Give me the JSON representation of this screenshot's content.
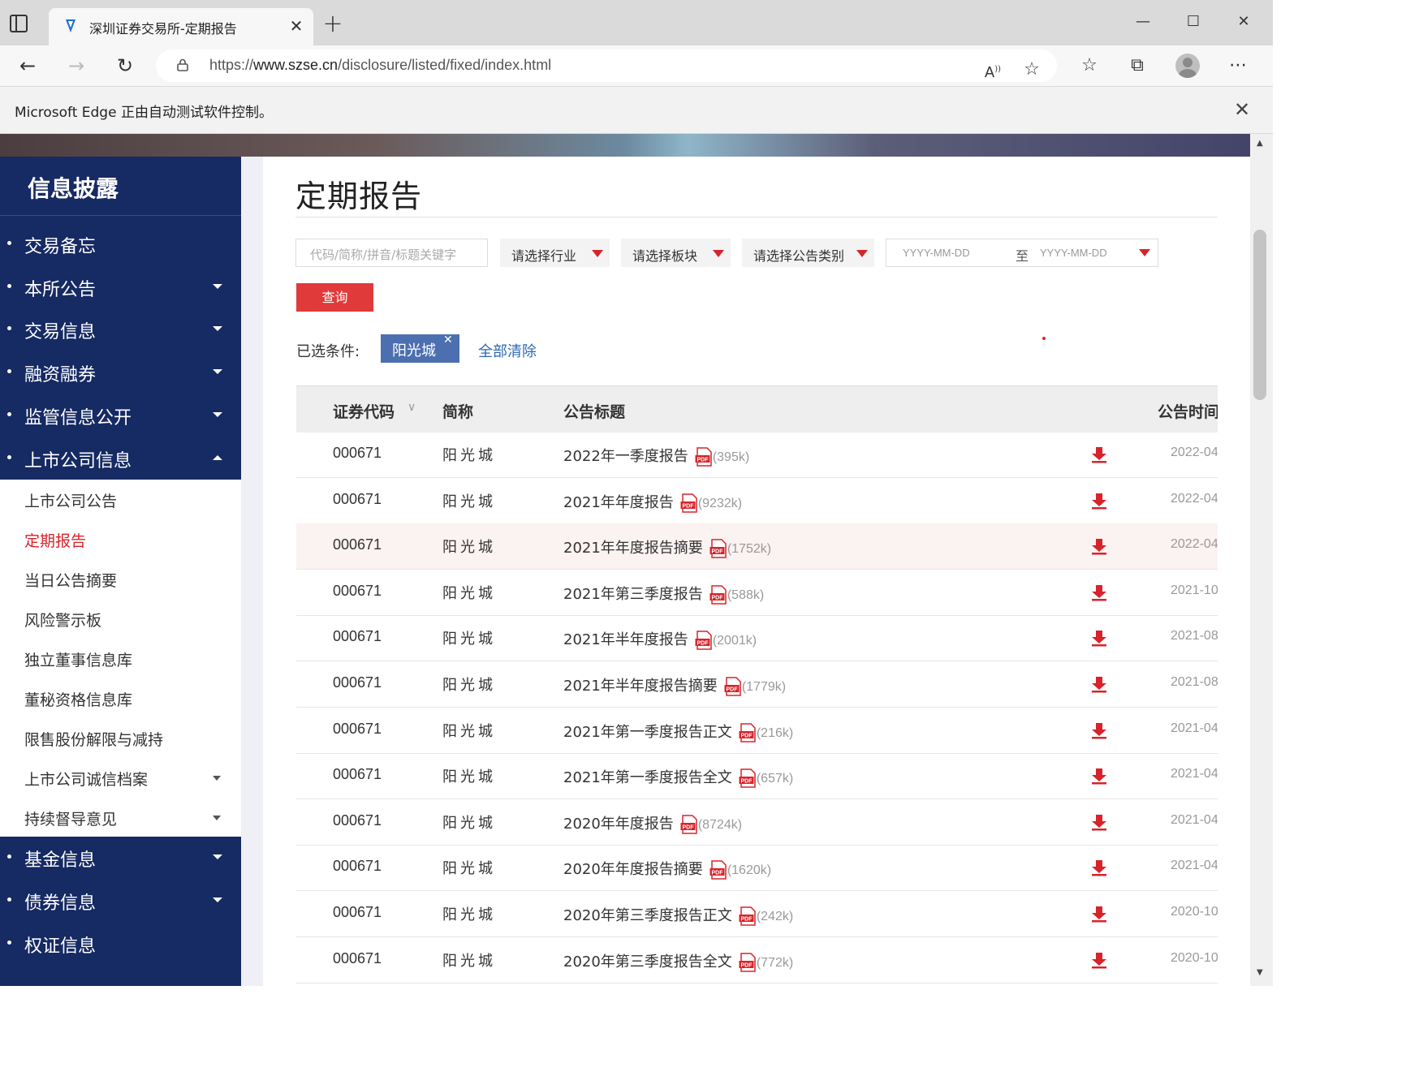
{
  "browser": {
    "tab_title": "深圳证券交易所-定期报告",
    "url_prefix": "https://",
    "url_host": "www.szse.cn",
    "url_path": "/disclosure/listed/fixed/index.html",
    "infobar_text": "Microsoft Edge 正由自动测试软件控制。"
  },
  "sidebar": {
    "header": "信息披露",
    "top_items": [
      {
        "label": "交易备忘"
      },
      {
        "label": "本所公告"
      },
      {
        "label": "交易信息"
      },
      {
        "label": "融资融券"
      },
      {
        "label": "监管信息公开"
      },
      {
        "label": "上市公司信息"
      }
    ],
    "sub_items": [
      {
        "label": "上市公司公告"
      },
      {
        "label": "定期报告"
      },
      {
        "label": "当日公告摘要"
      },
      {
        "label": "风险警示板"
      },
      {
        "label": "独立董事信息库"
      },
      {
        "label": "董秘资格信息库"
      },
      {
        "label": "限售股份解限与减持"
      },
      {
        "label": "上市公司诚信档案"
      },
      {
        "label": "持续督导意见"
      }
    ],
    "bottom_items": [
      {
        "label": "基金信息"
      },
      {
        "label": "债券信息"
      },
      {
        "label": "权证信息"
      }
    ]
  },
  "main": {
    "title": "定期报告",
    "search_placeholder": "代码/简称/拼音/标题关键字",
    "select_industry": "请选择行业",
    "select_board": "请选择板块",
    "select_type": "请选择公告类别",
    "date_from_placeholder": "YYYY-MM-DD",
    "date_to_label": "至",
    "date_to_placeholder": "YYYY-MM-DD",
    "query_button": "查询",
    "conditions_label": "已选条件:",
    "condition_tag": "阳光城",
    "clear_all": "全部清除"
  },
  "table": {
    "headers": {
      "code": "证券代码",
      "name": "简称",
      "title": "公告标题",
      "time": "公告时间"
    },
    "rows": [
      {
        "code": "000671",
        "name": "阳光城",
        "title": "2022年一季度报告",
        "size": "(395k)",
        "date": "2022-04"
      },
      {
        "code": "000671",
        "name": "阳光城",
        "title": "2021年年度报告",
        "size": "(9232k)",
        "date": "2022-04"
      },
      {
        "code": "000671",
        "name": "阳光城",
        "title": "2021年年度报告摘要",
        "size": "(1752k)",
        "date": "2022-04"
      },
      {
        "code": "000671",
        "name": "阳光城",
        "title": "2021年第三季度报告",
        "size": "(588k)",
        "date": "2021-10"
      },
      {
        "code": "000671",
        "name": "阳光城",
        "title": "2021年半年度报告",
        "size": "(2001k)",
        "date": "2021-08"
      },
      {
        "code": "000671",
        "name": "阳光城",
        "title": "2021年半年度报告摘要",
        "size": "(1779k)",
        "date": "2021-08"
      },
      {
        "code": "000671",
        "name": "阳光城",
        "title": "2021年第一季度报告正文",
        "size": "(216k)",
        "date": "2021-04"
      },
      {
        "code": "000671",
        "name": "阳光城",
        "title": "2021年第一季度报告全文",
        "size": "(657k)",
        "date": "2021-04"
      },
      {
        "code": "000671",
        "name": "阳光城",
        "title": "2020年年度报告",
        "size": "(8724k)",
        "date": "2021-04"
      },
      {
        "code": "000671",
        "name": "阳光城",
        "title": "2020年年度报告摘要",
        "size": "(1620k)",
        "date": "2021-04"
      },
      {
        "code": "000671",
        "name": "阳光城",
        "title": "2020年第三季度报告正文",
        "size": "(242k)",
        "date": "2020-10"
      },
      {
        "code": "000671",
        "name": "阳光城",
        "title": "2020年第三季度报告全文",
        "size": "(772k)",
        "date": "2020-10"
      }
    ]
  },
  "colors": {
    "sidebar_bg": "#162a63",
    "accent_red": "#d8232a",
    "tag_blue": "#4c6fb0",
    "link_blue": "#2c68b4"
  }
}
